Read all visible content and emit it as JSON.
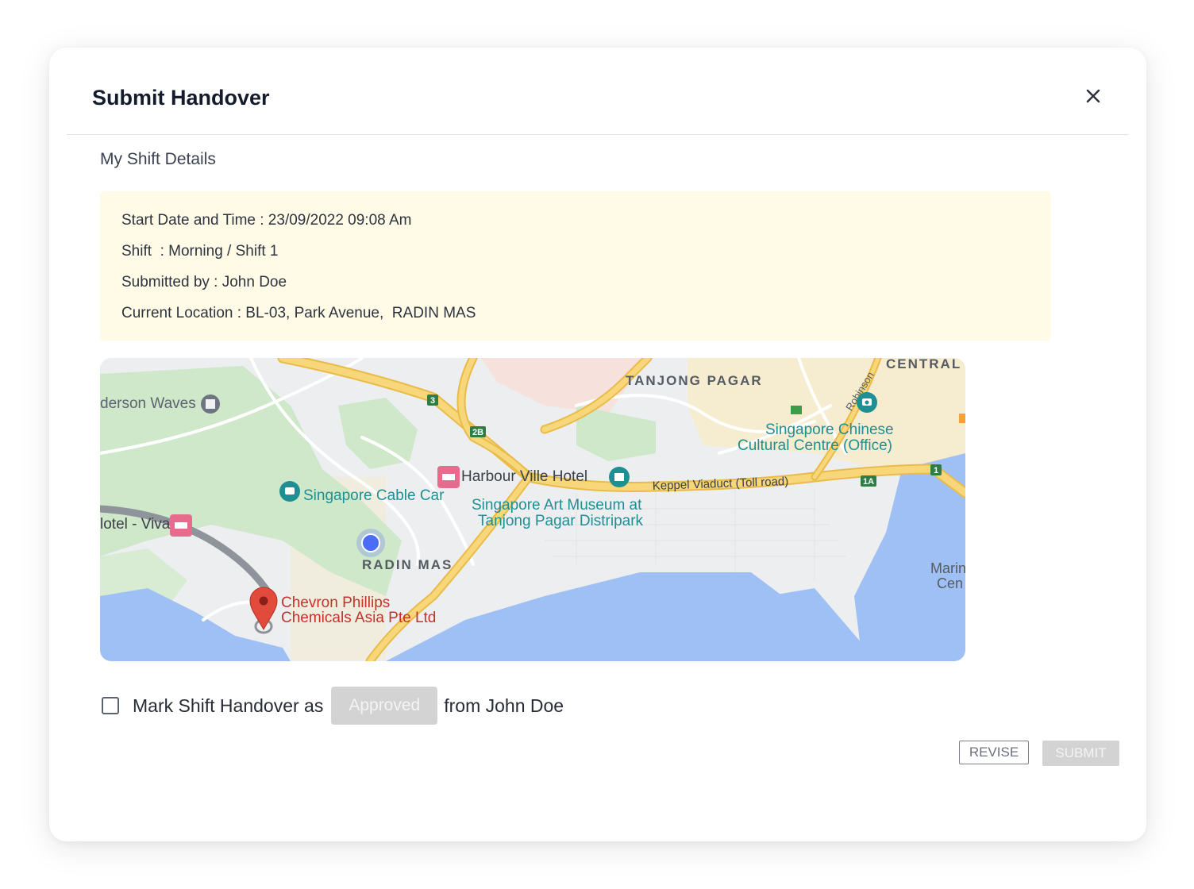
{
  "modal": {
    "title": "Submit Handover",
    "close_icon": "close-icon"
  },
  "shift": {
    "section_title": "My Shift Details",
    "rows": [
      {
        "text": "Start Date and Time : 23/09/2022 09:08 Am"
      },
      {
        "text": "Shift  : Morning / Shift 1"
      },
      {
        "text": "Submitted by : John Doe"
      },
      {
        "text": "Current Location : BL-03, Park Avenue,  RADIN MAS"
      }
    ]
  },
  "map": {
    "labels": {
      "tanjong_pagar": "TANJONG PAGAR",
      "central": "CENTRAL",
      "robinson": "Robinson",
      "henderson_waves": "derson Waves",
      "chinese_centre_1": "Singapore Chinese",
      "chinese_centre_2": "Cultural Centre (Office)",
      "harbour_ville": "Harbour Ville Hotel",
      "keppel_viaduct": "Keppel Viaduct (Toll road)",
      "cable_car": "Singapore Cable Car",
      "art_museum_1": "Singapore Art Museum at",
      "art_museum_2": "Tanjong Pagar Distripark",
      "hotel_viva": "lotel - Viva",
      "radin_mas": "RADIN MAS",
      "chevron_1": "Chevron Phillips",
      "chevron_2": "Chemicals Asia Pte Ltd",
      "marina_1": "Marin",
      "marina_2": "Cen",
      "shield_3": "3",
      "shield_2b": "2B",
      "shield_1a": "1A",
      "shield_1": "1"
    },
    "colors": {
      "land": "#eceef0",
      "park": "#cfe8c9",
      "water": "#9fc0f5",
      "highway": "#f8d77a",
      "highway_edge": "#e9bb49",
      "pin": "#e24a3b",
      "location_dot": "#4a6cf7",
      "poi_teal": "#1e8f93",
      "poi_pink": "#e66b8d"
    }
  },
  "handover": {
    "prefix": "Mark Shift Handover as",
    "status": "Approved",
    "suffix": "from John Doe"
  },
  "actions": {
    "revise": "REVISE",
    "submit": "SUBMIT"
  }
}
